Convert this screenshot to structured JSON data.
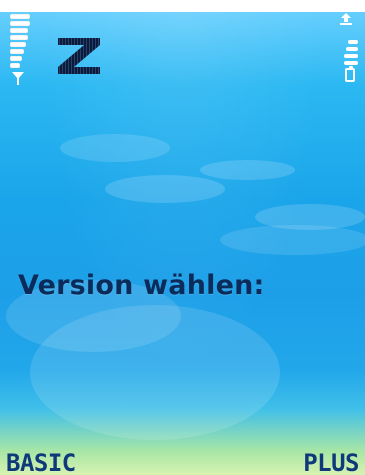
{
  "screen": {
    "prompt_text": "Version wählen:"
  },
  "softkeys": {
    "left_label": "BASIC",
    "right_label": "PLUS"
  },
  "status": {
    "signal_bars_visible": 8,
    "battery_bars_visible": 4,
    "network_logo_letter": "Z"
  },
  "icons": {
    "antenna": "antenna-icon",
    "network_logo": "network-logo",
    "upload": "upload-icon",
    "battery": "battery-icon"
  },
  "colors": {
    "prompt_text": "#0b2b5b",
    "softkey_text": "#0e3a79",
    "status_white": "#ffffff"
  }
}
